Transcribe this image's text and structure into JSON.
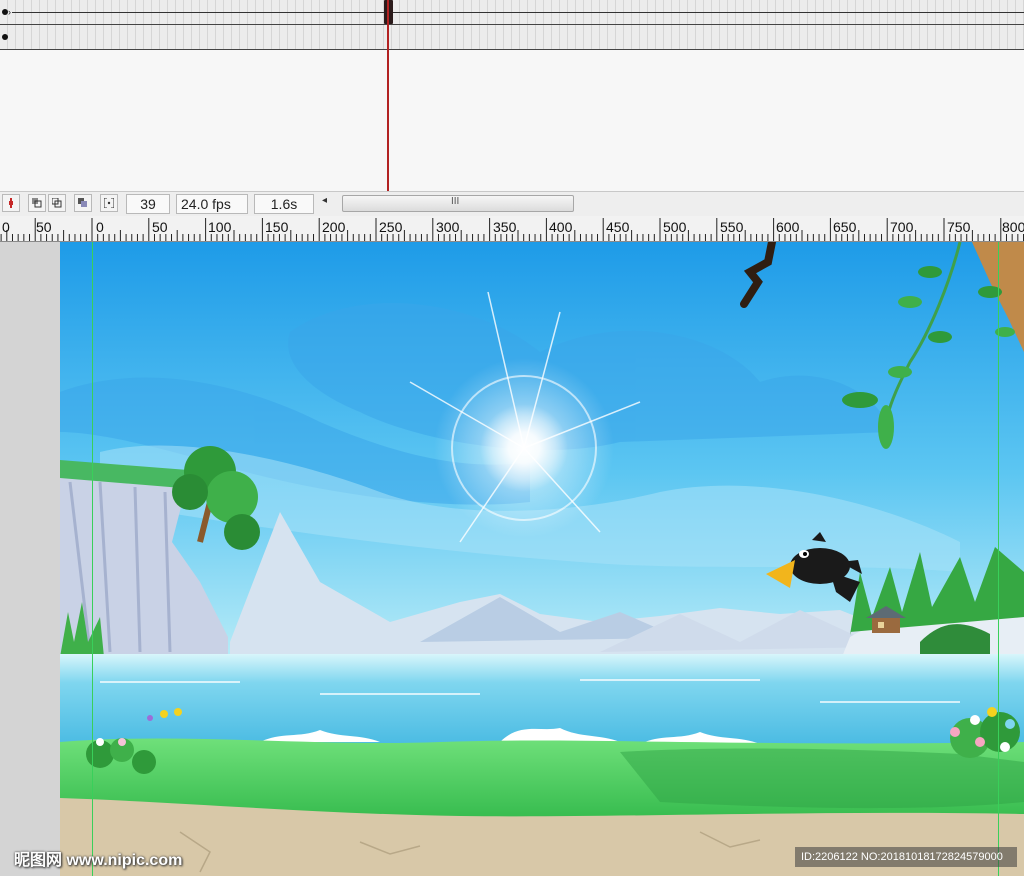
{
  "timeline": {
    "current_frame": "39",
    "fps": "24.0 fps",
    "elapsed": "1.6s",
    "scroll_grip": "III",
    "scroll_left_arrow": "◂"
  },
  "ruler": {
    "labels": [
      "0",
      "50",
      "0",
      "50",
      "100",
      "150",
      "200",
      "250",
      "300",
      "350",
      "400",
      "450",
      "500",
      "550",
      "600",
      "650",
      "700",
      "750",
      "800"
    ]
  },
  "scene": {
    "sky_top_color": "#1e9be8",
    "sky_bottom_color": "#b9ecf7",
    "water_color": "#6cd0ec",
    "grass_color": "#4fd25c",
    "ground_color": "#d8c8a8",
    "guide_color": "#39d05a",
    "playhead_color": "#b22222",
    "elements": [
      "sun",
      "cliff",
      "tree",
      "mountains",
      "lake",
      "crow",
      "branch",
      "vine-leaves",
      "flowers",
      "house",
      "grass"
    ]
  },
  "watermarks": {
    "left": "昵图网 www.nipic.com",
    "right": "ID:2206122 NO:20181018172824579000"
  }
}
